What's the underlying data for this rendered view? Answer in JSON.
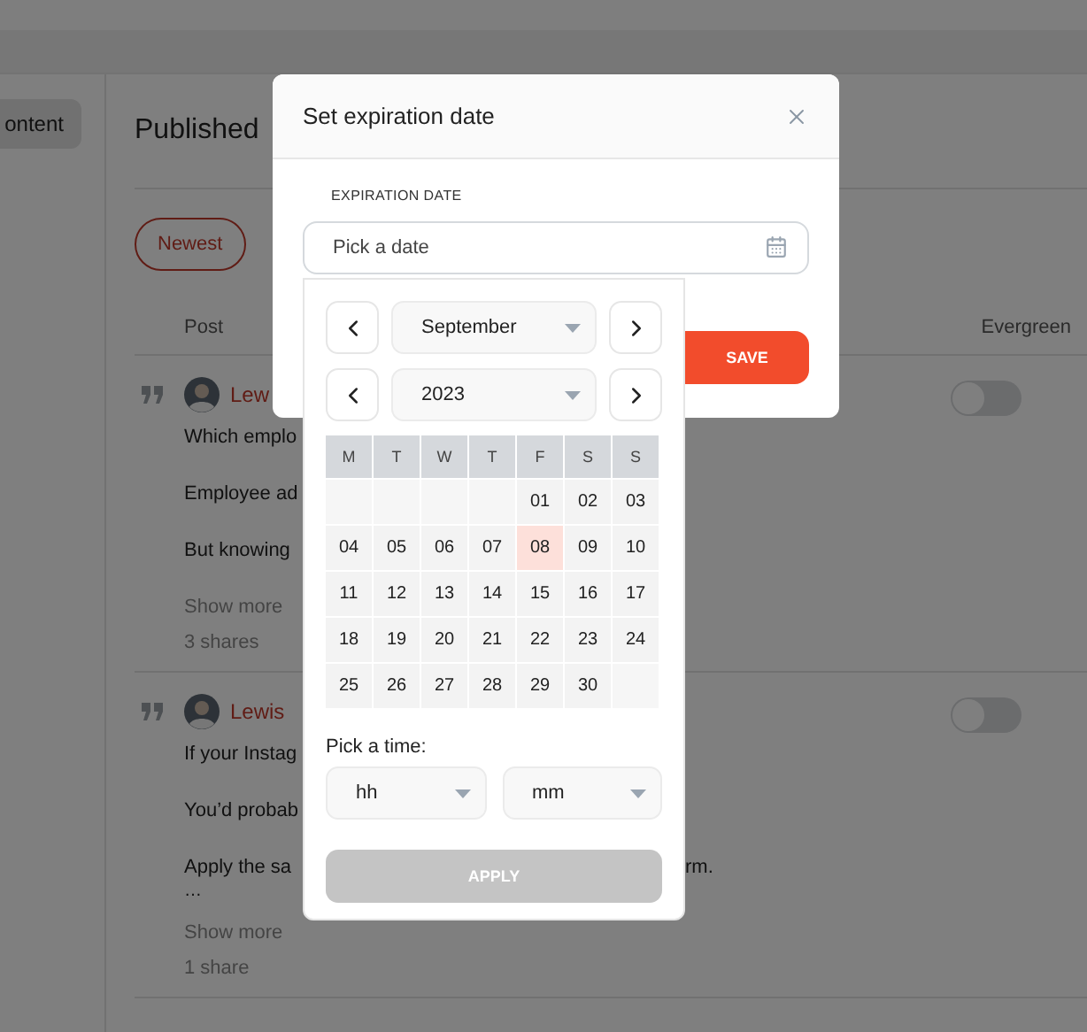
{
  "sidebar": {
    "items": [
      {
        "label": "ontent",
        "selected": true
      }
    ]
  },
  "main": {
    "title": "Published",
    "filters": [
      {
        "label": "Newest",
        "selected": true
      }
    ]
  },
  "table": {
    "columns": [
      "Post",
      "Evergreen"
    ],
    "rows": [
      {
        "author": "Lew",
        "paragraphs": [
          [
            "Which emplo"
          ],
          [
            "Employee ad"
          ],
          [
            "But knowing"
          ]
        ],
        "show_more": "Show more",
        "shares": "3 shares",
        "evergreen": false
      },
      {
        "author": "Lewis",
        "paragraphs": [
          [
            "If your Instag"
          ],
          [
            "You’d probab"
          ],
          [
            "Apply the sa",
            "rm."
          ]
        ],
        "ellipsis": "…",
        "show_more": "Show more",
        "shares": "1 share",
        "evergreen": false
      }
    ]
  },
  "modal": {
    "title": "Set expiration date",
    "field_label": "EXPIRATION DATE",
    "date_field": {
      "placeholder": "Pick a date"
    },
    "save": "SAVE"
  },
  "datepicker": {
    "month": "September",
    "year": "2023",
    "weekdays": [
      "M",
      "T",
      "W",
      "T",
      "F",
      "S",
      "S"
    ],
    "days": [
      {
        "kind": "blank"
      },
      {
        "kind": "blank"
      },
      {
        "kind": "blank"
      },
      {
        "kind": "blank"
      },
      {
        "kind": "day",
        "label": "01",
        "highlighted": false
      },
      {
        "kind": "day",
        "label": "02",
        "highlighted": false
      },
      {
        "kind": "day",
        "label": "03",
        "highlighted": false
      },
      {
        "kind": "day",
        "label": "04",
        "highlighted": false
      },
      {
        "kind": "day",
        "label": "05",
        "highlighted": false
      },
      {
        "kind": "day",
        "label": "06",
        "highlighted": false
      },
      {
        "kind": "day",
        "label": "07",
        "highlighted": false
      },
      {
        "kind": "day",
        "label": "08",
        "highlighted": true
      },
      {
        "kind": "day",
        "label": "09",
        "highlighted": false
      },
      {
        "kind": "day",
        "label": "10",
        "highlighted": false
      },
      {
        "kind": "day",
        "label": "11",
        "highlighted": false
      },
      {
        "kind": "day",
        "label": "12",
        "highlighted": false
      },
      {
        "kind": "day",
        "label": "13",
        "highlighted": false
      },
      {
        "kind": "day",
        "label": "14",
        "highlighted": false
      },
      {
        "kind": "day",
        "label": "15",
        "highlighted": false
      },
      {
        "kind": "day",
        "label": "16",
        "highlighted": false
      },
      {
        "kind": "day",
        "label": "17",
        "highlighted": false
      },
      {
        "kind": "day",
        "label": "18",
        "highlighted": false
      },
      {
        "kind": "day",
        "label": "19",
        "highlighted": false
      },
      {
        "kind": "day",
        "label": "20",
        "highlighted": false
      },
      {
        "kind": "day",
        "label": "21",
        "highlighted": false
      },
      {
        "kind": "day",
        "label": "22",
        "highlighted": false
      },
      {
        "kind": "day",
        "label": "23",
        "highlighted": false
      },
      {
        "kind": "day",
        "label": "24",
        "highlighted": false
      },
      {
        "kind": "day",
        "label": "25",
        "highlighted": false
      },
      {
        "kind": "day",
        "label": "26",
        "highlighted": false
      },
      {
        "kind": "day",
        "label": "27",
        "highlighted": false
      },
      {
        "kind": "day",
        "label": "28",
        "highlighted": false
      },
      {
        "kind": "day",
        "label": "29",
        "highlighted": false
      },
      {
        "kind": "day",
        "label": "30",
        "highlighted": false
      },
      {
        "kind": "blank"
      }
    ],
    "time_label": "Pick a time:",
    "hour": {
      "placeholder": "hh"
    },
    "minute": {
      "placeholder": "mm"
    },
    "apply": {
      "label": "APPLY",
      "disabled": true
    }
  }
}
